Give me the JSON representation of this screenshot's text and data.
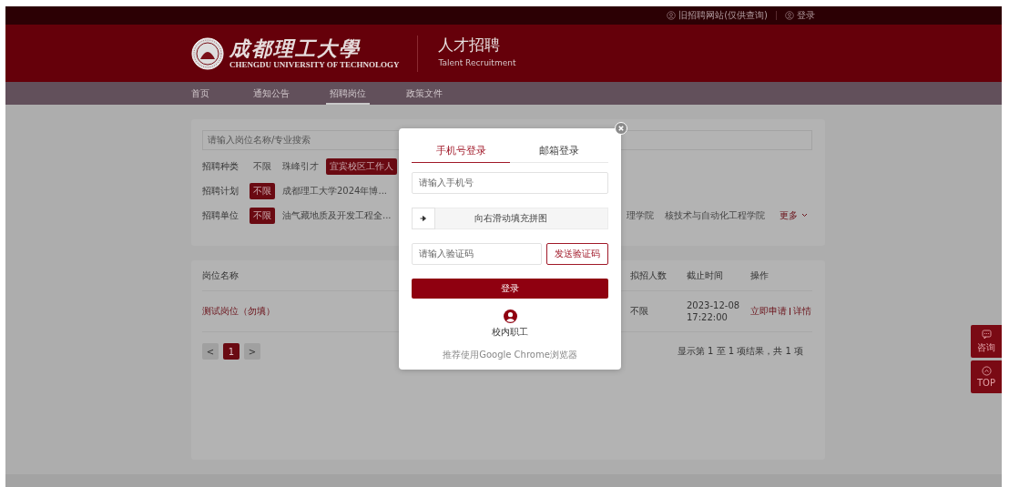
{
  "top_bar": {
    "links": [
      {
        "label": "旧招聘网站(仅供查询)"
      },
      {
        "label": "登录"
      }
    ]
  },
  "header": {
    "school_name": "成都理工大學",
    "school_name_en": "CHENGDU UNIVERSITY OF TECHNOLOGY",
    "title": "人才招聘",
    "subtitle": "Talent Recruitment"
  },
  "nav": [
    {
      "label": "首页",
      "selected": false
    },
    {
      "label": "通知公告",
      "selected": false
    },
    {
      "label": "招聘岗位",
      "selected": true
    },
    {
      "label": "政策文件",
      "selected": false
    }
  ],
  "search": {
    "placeholder": "请输入岗位名称/专业搜索"
  },
  "filters": [
    {
      "label": "招聘种类",
      "options": [
        {
          "label": "不限",
          "selected": false
        },
        {
          "label": "珠峰引才",
          "selected": false
        },
        {
          "label": "宜宾校区工作人",
          "selected": true
        }
      ]
    },
    {
      "label": "招聘计划",
      "options": [
        {
          "label": "不限",
          "selected": true
        },
        {
          "label": "成都理工大学2024年博...",
          "selected": false
        }
      ]
    },
    {
      "label": "招聘单位",
      "options": [
        {
          "label": "不限",
          "selected": true
        },
        {
          "label": "油气藏地质及开发工程全...",
          "selected": false
        },
        {
          "label": "理学院",
          "selected": false
        },
        {
          "label": "核技术与自动化工程学院",
          "selected": false
        }
      ],
      "more": "更多"
    }
  ],
  "table": {
    "columns": [
      "岗位名称",
      "拟招人数",
      "截止时间",
      "操作"
    ],
    "rows": [
      {
        "name": "测试岗位（勿填）",
        "count": "不限",
        "deadline": "2023-12-08 17:22:00",
        "apply": "立即申请",
        "details": "详情"
      }
    ]
  },
  "pagination": {
    "prev": "<",
    "pages": [
      {
        "label": "1",
        "selected": true
      }
    ],
    "next": ">",
    "summary": "显示第 1 至 1 项结果，共 1 项"
  },
  "login_dialog": {
    "tabs": [
      {
        "label": "手机号登录",
        "selected": true
      },
      {
        "label": "邮箱登录",
        "selected": false
      }
    ],
    "phone": {
      "placeholder": "请输入手机号"
    },
    "slider": {
      "label": "向右滑动填充拼图"
    },
    "code": {
      "placeholder": "请输入验证码"
    },
    "send_code": "发送验证码",
    "submit": "登录",
    "staff_login": "校内职工",
    "hint": "推荐使用Google Chrome浏览器"
  },
  "side_buttons": [
    {
      "kind": "consult",
      "label": "咨询"
    },
    {
      "kind": "top",
      "label": "TOP"
    }
  ]
}
